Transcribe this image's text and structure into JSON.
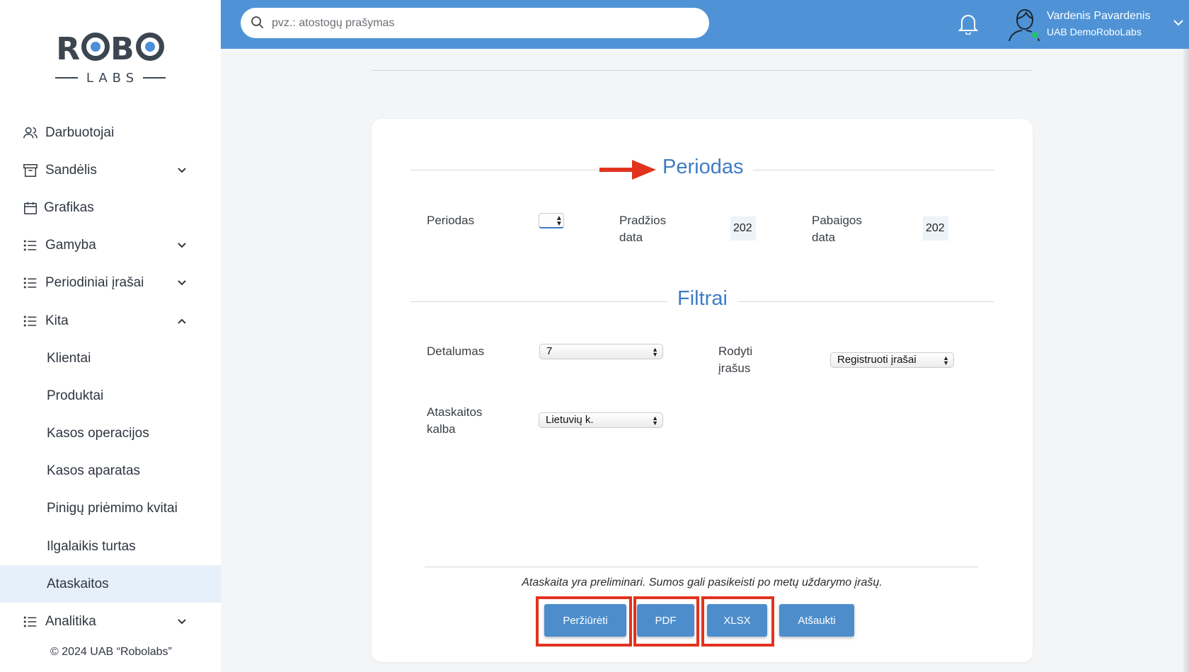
{
  "sidebar": {
    "logo": {
      "brand": "ROBO",
      "sub": "LABS"
    },
    "items": [
      {
        "label": "Darbuotojai",
        "icon": "users-icon",
        "expandable": false
      },
      {
        "label": "Sandėlis",
        "icon": "archive-icon",
        "expandable": true,
        "expanded": false
      },
      {
        "label": "Grafikas",
        "icon": "calendar-icon",
        "expandable": false
      },
      {
        "label": "Gamyba",
        "icon": "list-icon",
        "expandable": true,
        "expanded": false
      },
      {
        "label": "Periodiniai įrašai",
        "icon": "list-icon",
        "expandable": true,
        "expanded": false
      },
      {
        "label": "Kita",
        "icon": "list-icon",
        "expandable": true,
        "expanded": true
      },
      {
        "label": "Klientai",
        "sub": true
      },
      {
        "label": "Produktai",
        "sub": true
      },
      {
        "label": "Kasos operacijos",
        "sub": true
      },
      {
        "label": "Kasos aparatas",
        "sub": true
      },
      {
        "label": "Pinigų priėmimo kvitai",
        "sub": true
      },
      {
        "label": "Ilgalaikis turtas",
        "sub": true
      },
      {
        "label": "Ataskaitos",
        "sub": true,
        "active": true
      },
      {
        "label": "Analitika",
        "icon": "list-icon",
        "expandable": true,
        "expanded": false
      }
    ],
    "copyright": "© 2024 UAB “Robolabs”"
  },
  "topbar": {
    "search_placeholder": "pvz.: atostogų prašymas",
    "user_name": "Vardenis Pavardenis",
    "user_company": "UAB DemoRoboLabs",
    "status_color": "#27c06c"
  },
  "form": {
    "period_section_title": "Periodas",
    "filters_section_title": "Filtrai",
    "period_label": "Periodas",
    "period_value": "",
    "start_date_label": "Pradžios data",
    "start_date_value": "202",
    "end_date_label": "Pabaigos data",
    "end_date_value": "202",
    "detail_label": "Detalumas",
    "detail_value": "7",
    "show_entries_label": "Rodyti įrašus",
    "show_entries_value": "Registruoti įrašai",
    "report_language_label": "Ataskaitos kalba",
    "report_language_value": "Lietuvių k.",
    "note": "Ataskaita yra preliminari. Sumos gali pasikeisti po metų uždarymo įrašų."
  },
  "buttons": {
    "view": "Peržiūrėti",
    "pdf": "PDF",
    "xlsx": "XLSX",
    "cancel": "Atšaukti"
  },
  "colors": {
    "accent": "#4f93d6",
    "button": "#4d8dcc",
    "section_title": "#3f7cc4",
    "highlight": "#e2331f",
    "active_bg": "#e6f0fa"
  }
}
